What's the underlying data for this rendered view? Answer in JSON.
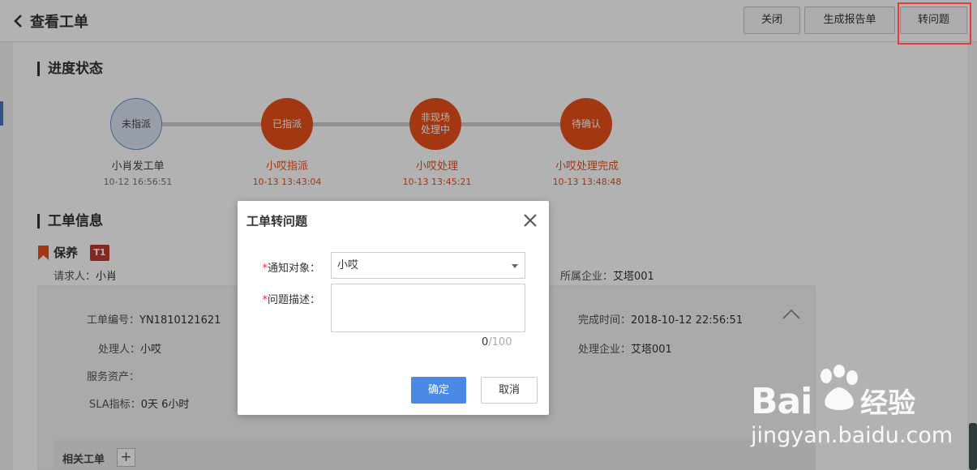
{
  "header": {
    "title": "查看工单",
    "close_label": "关闭",
    "report_label": "生成报告单",
    "convert_label": "转问题"
  },
  "progress": {
    "section_title": "进度状态",
    "steps": [
      {
        "status": "未指派",
        "action": "小肖发工单",
        "time": "10-12 16:56:51",
        "state": "pending"
      },
      {
        "status": "已指派",
        "action": "小哎指派",
        "time": "10-13 13:43:04",
        "state": "done"
      },
      {
        "status_line1": "非现场",
        "status_line2": "处理中",
        "action": "小哎处理",
        "time": "10-13 13:45:21",
        "state": "done"
      },
      {
        "status": "待确认",
        "action": "小哎处理完成",
        "time": "10-13 13:48:48",
        "state": "done"
      }
    ]
  },
  "order_info": {
    "section_title": "工单信息",
    "type": "保养",
    "level": "T1",
    "requester_label": "请求人：",
    "requester": "小肖",
    "company_label": "所属企业：",
    "company": "艾塔001",
    "order_no_label": "工单编号：",
    "order_no": "YN1810121621",
    "finish_time_label": "完成时间：",
    "finish_time": "2018-10-12 22:56:51",
    "handler_label": "处理人：",
    "handler": "小哎",
    "handler_company_label": "处理企业：",
    "handler_company": "艾塔001",
    "asset_label": "服务资产：",
    "sla_label": "SLA指标：",
    "sla": "0天 6小时",
    "related_label": "相关工单",
    "add_symbol": "+"
  },
  "modal": {
    "title": "工单转问题",
    "target_label": "通知对象：",
    "target_value": "小哎",
    "desc_label": "问题描述：",
    "required_mark": "*",
    "char_current": "0",
    "char_max": "/100",
    "confirm_label": "确定",
    "cancel_label": "取消"
  },
  "watermark": {
    "brand_left": "Bai",
    "brand_right": "经验",
    "url": "jingyan.baidu.com"
  },
  "colors": {
    "accent_red": "#e8501a",
    "primary_blue": "#4a8ae6",
    "highlight_border": "#e8393d",
    "level_badge": "#c0392b"
  }
}
